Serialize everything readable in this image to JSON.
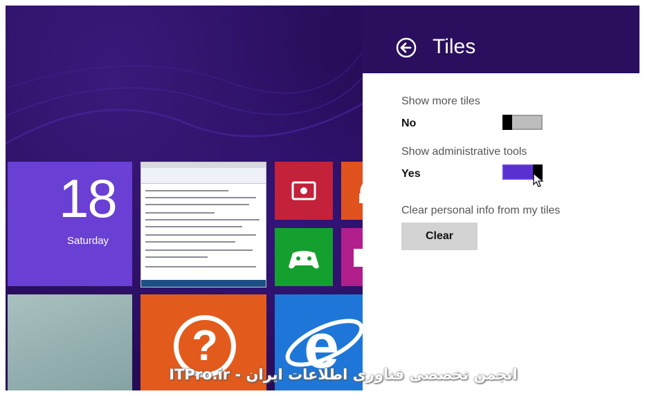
{
  "start_screen": {
    "clock_tile": {
      "date": "18",
      "day": "Saturday"
    },
    "tile_icons": {
      "video": "video-play-icon",
      "music": "headphones-icon",
      "games": "game-controller-icon",
      "photos": "photo-icon",
      "help": "help-question-icon",
      "ie": "internet-explorer-icon"
    },
    "tile_colors": {
      "clock": "#6a3fd3",
      "video": "#c4213b",
      "music": "#e0531e",
      "games": "#14a02e",
      "photos": "#b01f8c",
      "help": "#e25b1d",
      "ie": "#1e77d8"
    },
    "help_glyph": "?",
    "background_color": "#2b0f5e"
  },
  "settings_pane": {
    "title": "Tiles",
    "back_icon": "back-arrow-icon",
    "settings": [
      {
        "label": "Show more tiles",
        "value": "No",
        "toggle_on": false
      },
      {
        "label": "Show administrative tools",
        "value": "Yes",
        "toggle_on": true
      }
    ],
    "clear_section": {
      "label": "Clear personal info from my tiles",
      "button_label": "Clear"
    },
    "accent_color": "#5a2fd0"
  },
  "watermark": {
    "text": "ITPro.ir - انجمن تخصصی فناوری اطلاعات ایران"
  }
}
